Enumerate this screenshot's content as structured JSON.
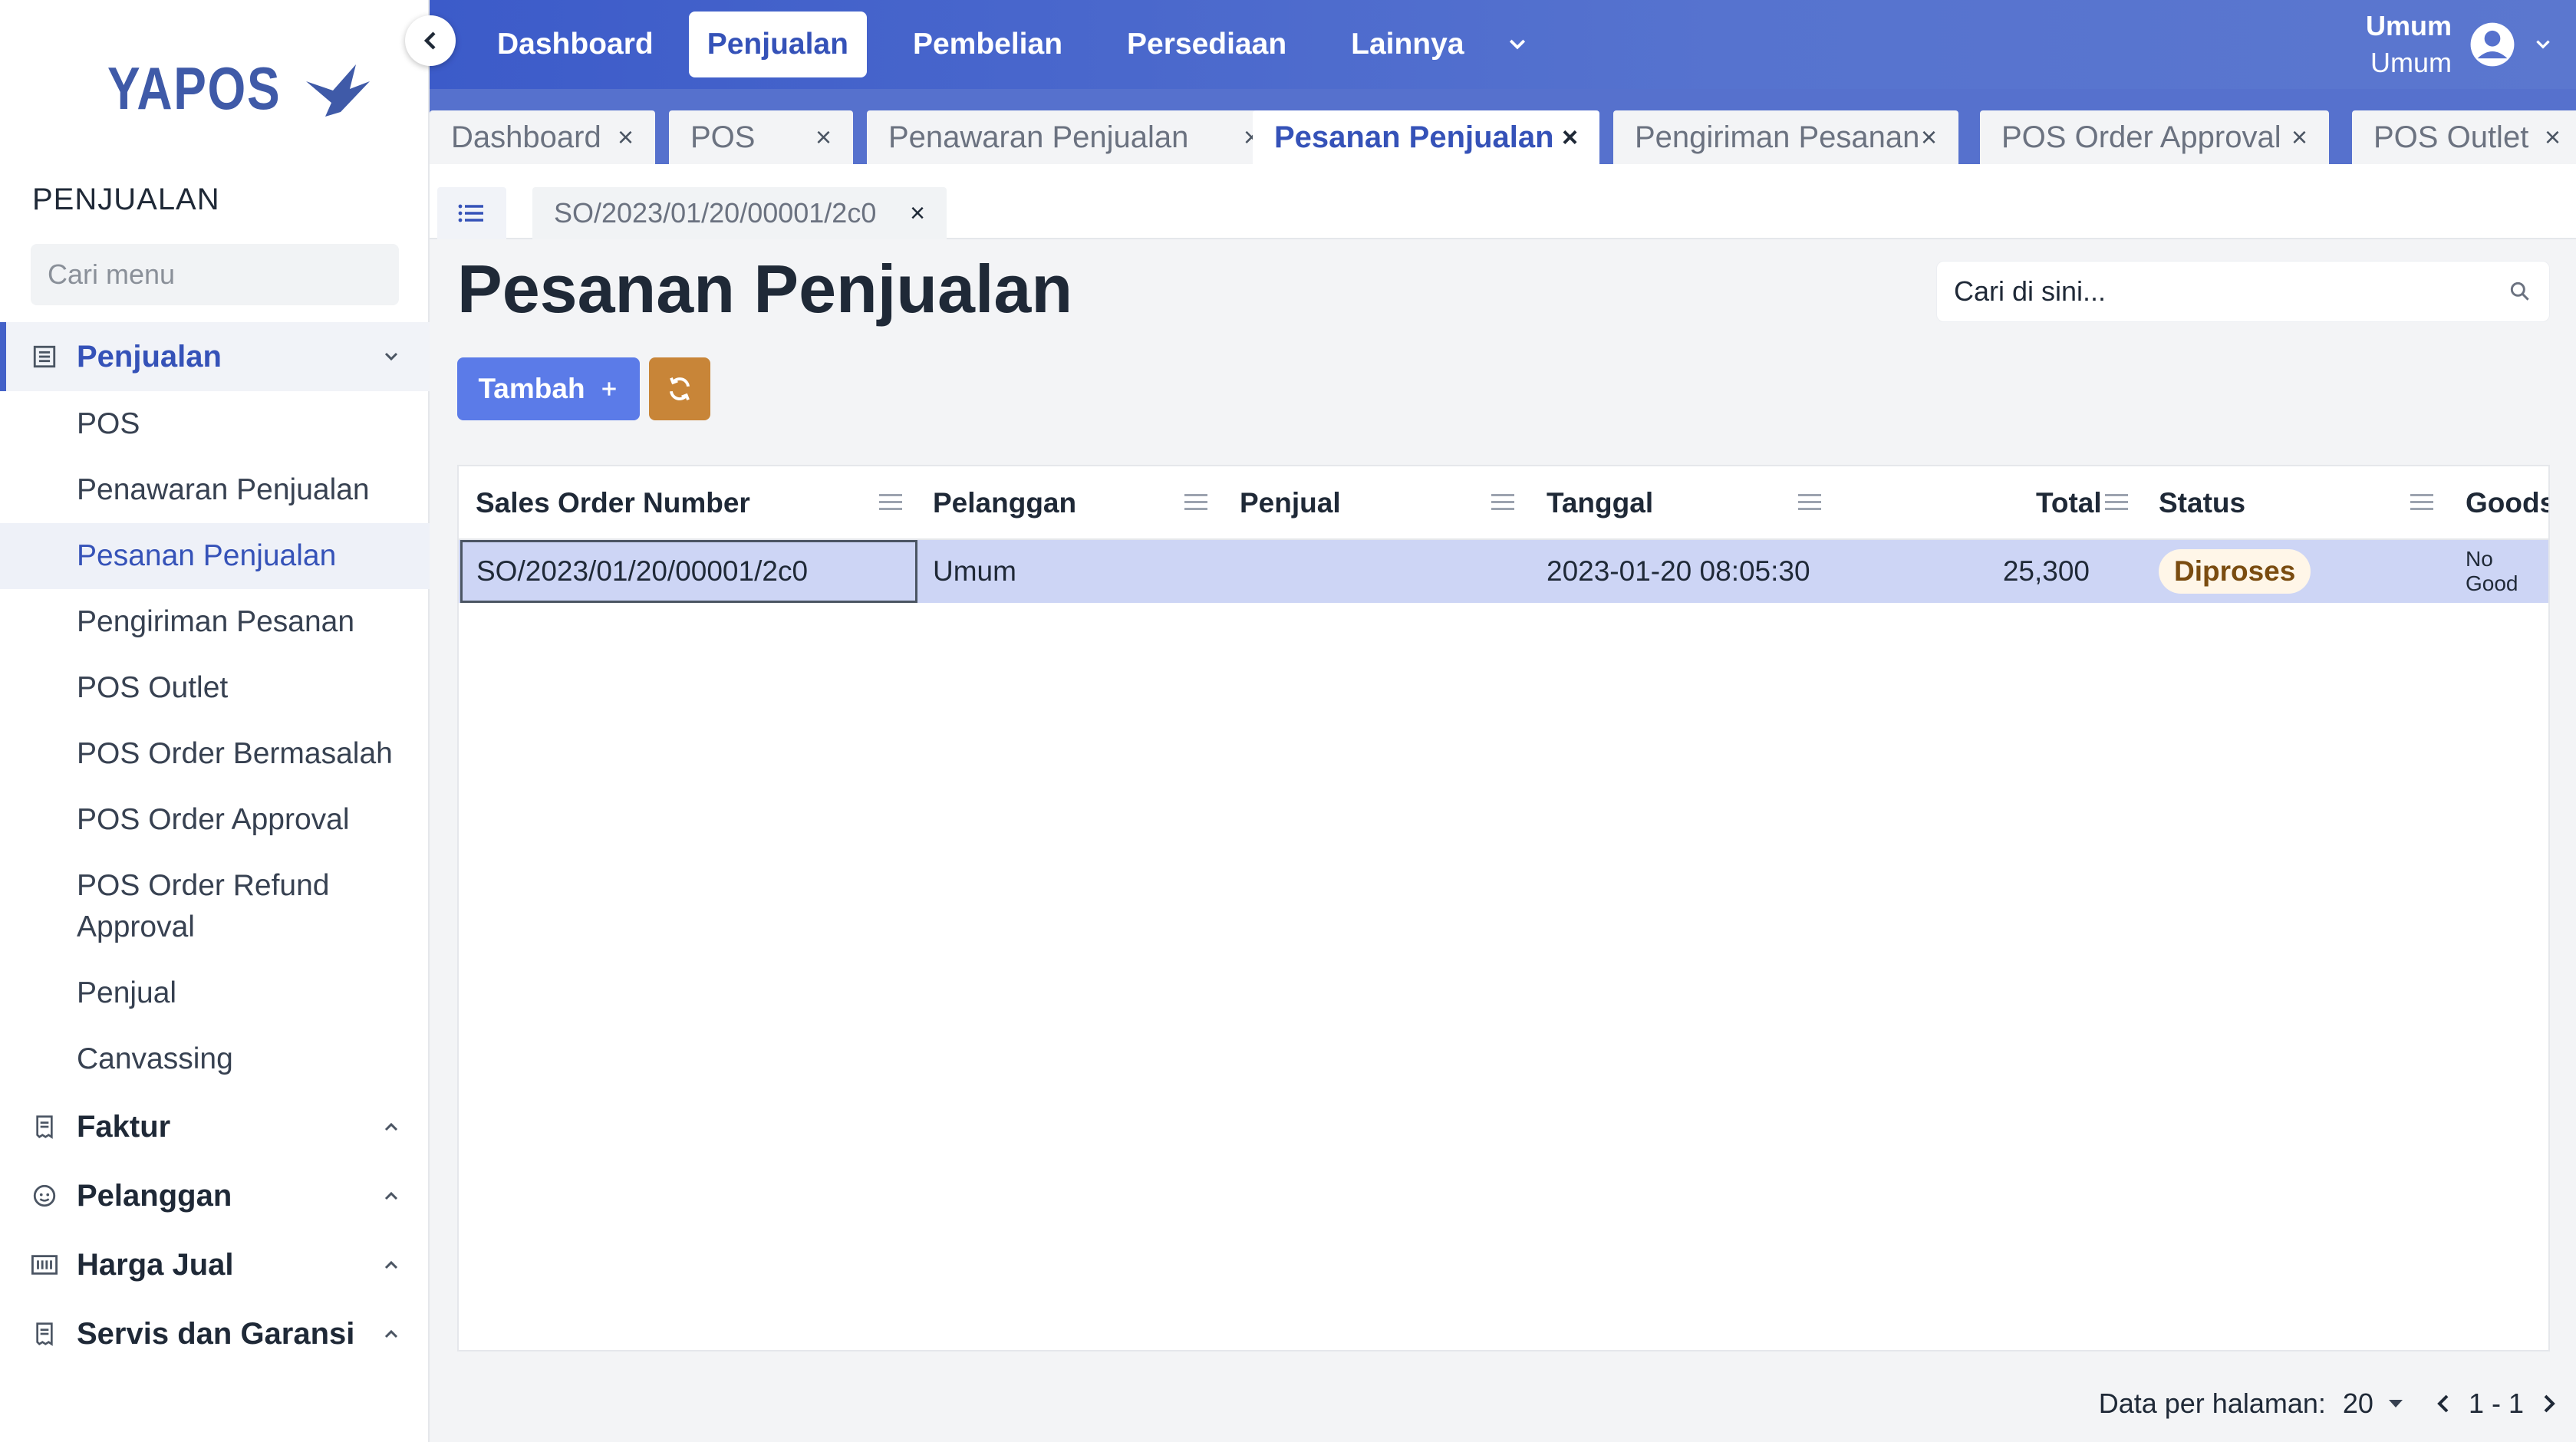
{
  "app": {
    "logo_text": "YAPOS"
  },
  "sidebar": {
    "section_title": "PENJUALAN",
    "search_placeholder": "Cari menu",
    "groups": [
      {
        "label": "Penjualan",
        "icon": "list-icon",
        "expanded": true,
        "items": [
          "POS",
          "Penawaran Penjualan",
          "Pesanan Penjualan",
          "Pengiriman Pesanan",
          "POS Outlet",
          "POS Order Bermasalah",
          "POS Order Approval",
          "POS Order Refund Approval",
          "Penjual",
          "Canvassing"
        ]
      },
      {
        "label": "Faktur",
        "icon": "receipt-icon",
        "expanded": false
      },
      {
        "label": "Pelanggan",
        "icon": "face-icon",
        "expanded": false
      },
      {
        "label": "Harga Jual",
        "icon": "barcode-icon",
        "expanded": false
      },
      {
        "label": "Servis dan Garansi",
        "icon": "receipt-icon",
        "expanded": false
      }
    ],
    "selected_item": "Pesanan Penjualan"
  },
  "topnav": {
    "items": [
      "Dashboard",
      "Penjualan",
      "Pembelian",
      "Persediaan",
      "Lainnya"
    ],
    "active": "Penjualan",
    "user_name": "Umum",
    "user_role": "Umum"
  },
  "tabs": [
    {
      "label": "Dashboard",
      "active": false
    },
    {
      "label": "POS",
      "active": false
    },
    {
      "label": "Penawaran Penjualan",
      "active": false
    },
    {
      "label": "Pesanan Penjualan",
      "active": true
    },
    {
      "label": "Pengiriman Pesanan",
      "active": false
    },
    {
      "label": "POS Order Approval",
      "active": false
    },
    {
      "label": "POS Outlet",
      "active": false
    }
  ],
  "doc_tab": {
    "label": "SO/2023/01/20/00001/2c0"
  },
  "page": {
    "title": "Pesanan Penjualan",
    "search_placeholder": "Cari di sini...",
    "add_label": "Tambah"
  },
  "table": {
    "columns": [
      "Sales Order Number",
      "Pelanggan",
      "Penjual",
      "Tanggal",
      "Total",
      "Status",
      "Goods"
    ],
    "rows": [
      {
        "so_number": "SO/2023/01/20/00001/2c0",
        "pelanggan": "Umum",
        "penjual": "",
        "tanggal": "2023-01-20 08:05:30",
        "total": "25,300",
        "status": "Diproses",
        "goods": "No Good"
      }
    ]
  },
  "pager": {
    "label": "Data per halaman:",
    "per_page": "20",
    "range": "1 - 1"
  },
  "colors": {
    "primary": "#4461c8",
    "refresh": "#c88538",
    "row_selected": "#cdd5f5"
  }
}
